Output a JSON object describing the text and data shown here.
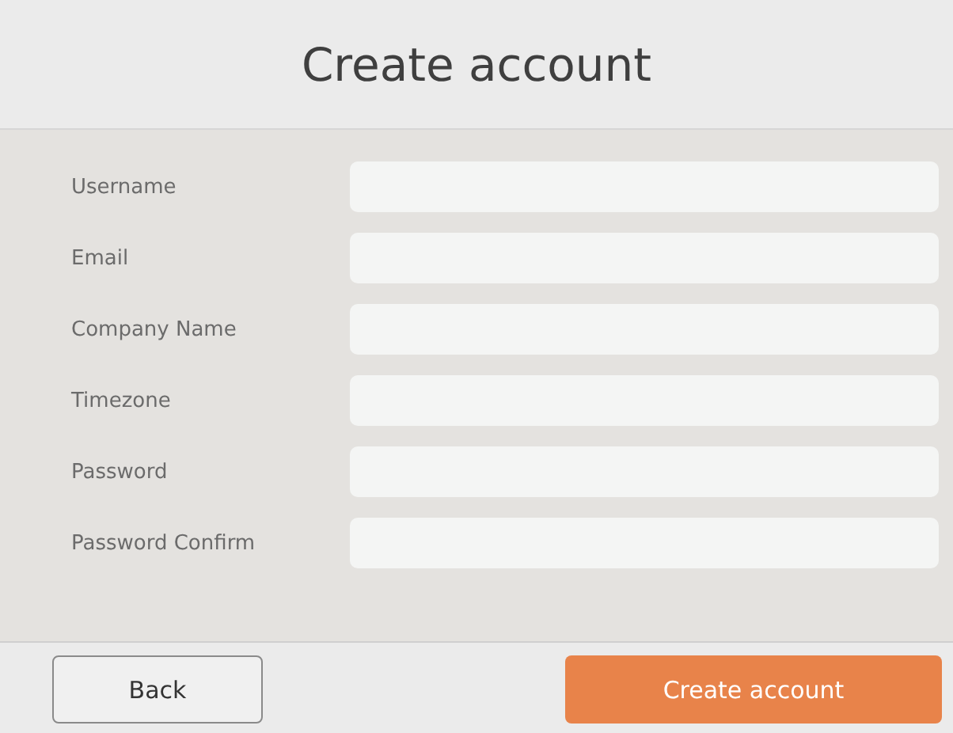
{
  "header": {
    "title": "Create account"
  },
  "fields": [
    {
      "label": "Username"
    },
    {
      "label": "Email"
    },
    {
      "label": "Company Name"
    },
    {
      "label": "Timezone"
    },
    {
      "label": "Password"
    },
    {
      "label": "Password Confirm"
    }
  ],
  "buttons": [
    {
      "label": "Back",
      "kind": "secondary"
    },
    {
      "label": "Create account",
      "kind": "primary"
    }
  ]
}
